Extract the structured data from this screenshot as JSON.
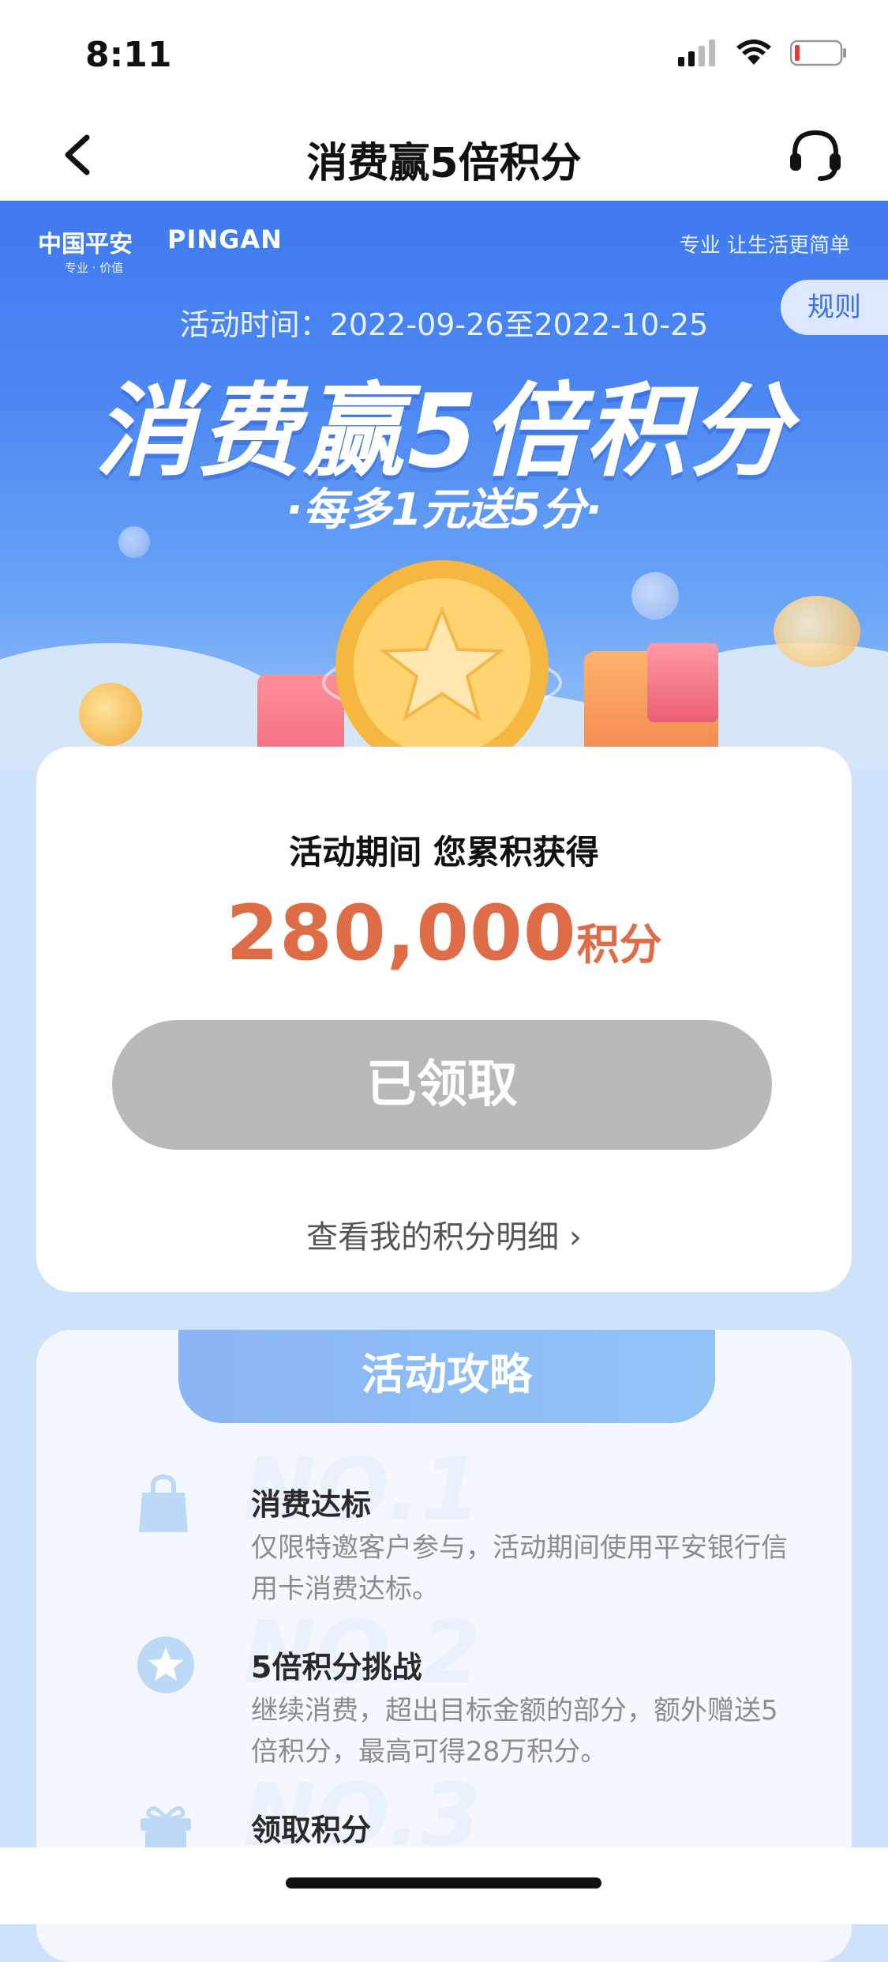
{
  "status_bar": {
    "time": "8:11"
  },
  "nav": {
    "title": "消费赢5倍积分"
  },
  "banner": {
    "brand_cn": "中国平安",
    "brand_en": "PINGAN",
    "brand_tagline": "专业 · 价值",
    "slogan": "专业 让生活更简单",
    "rules_label": "规则",
    "activity_time": "活动时间：2022-09-26至2022-10-25",
    "headline": "消费赢5倍积分",
    "subline": "·每多1元送5分·"
  },
  "points_card": {
    "label": "活动期间 您累积获得",
    "points_value": "280,000",
    "points_unit": "积分",
    "claim_button": "已领取",
    "detail_link": "查看我的积分明细 ›"
  },
  "guide": {
    "tab_title": "活动攻略",
    "steps": [
      {
        "number": "NO.1",
        "title": "消费达标",
        "desc": "仅限特邀客户参与，活动期间使用平安银行信用卡消费达标。",
        "icon": "shopping-bag-icon"
      },
      {
        "number": "NO.2",
        "title": "5倍积分挑战",
        "desc": "继续消费，超出目标金额的部分，额外赠送5倍积分，最高可得28万积分。",
        "icon": "star-badge-icon"
      },
      {
        "number": "NO.3",
        "title": "领取积分",
        "desc": "",
        "icon": "gift-icon"
      }
    ]
  },
  "colors": {
    "accent_orange": "#de6d47",
    "banner_blue": "#3f7af0",
    "button_disabled": "#b9b9b9"
  }
}
